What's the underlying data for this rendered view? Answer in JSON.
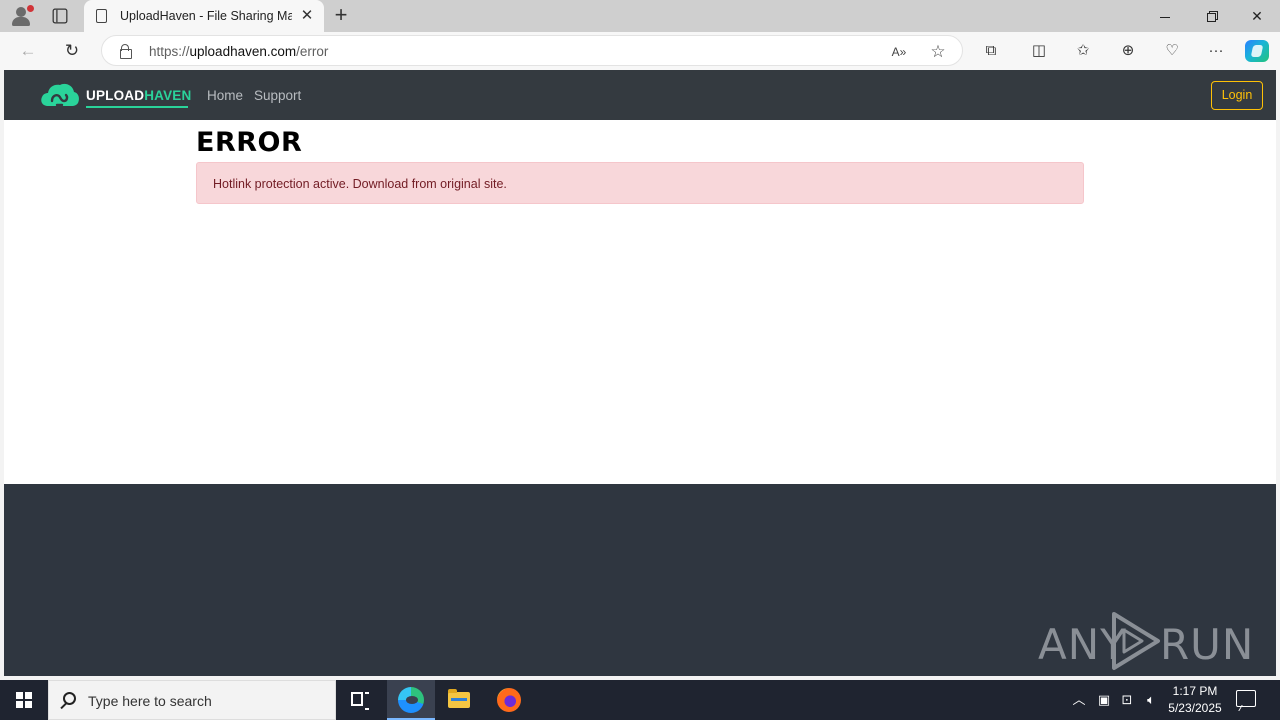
{
  "browser": {
    "tab_title": "UploadHaven - File Sharing Made Easy",
    "url_domain": "uploadhaven.com",
    "url_prefix": "https://",
    "url_path": "/error",
    "icons": [
      "profile-icon",
      "tab-actions-icon",
      "page-icon",
      "close-icon",
      "new-tab-icon",
      "back-icon",
      "reload-icon",
      "lock-icon",
      "read-aloud-icon",
      "favorite-star-icon",
      "extensions-icon",
      "split-screen-icon",
      "favorites-icon",
      "collections-icon",
      "browser-essentials-icon",
      "more-icon",
      "copilot-icon"
    ]
  },
  "site": {
    "logo_main": "UPLOAD",
    "logo_accent": "HAVEN",
    "nav": [
      "Home",
      "Support"
    ],
    "login_label": "Login",
    "error_heading": "ERROR",
    "error_message": "Hotlink protection active. Download from original site.",
    "colors": {
      "navbar": "#343a40",
      "accent": "#2ad39a",
      "login_border": "#ffc107",
      "alert_bg": "#f8d7da",
      "alert_text": "#721c24",
      "footer": "#2f3640"
    }
  },
  "watermark": {
    "left": "ANY",
    "right": "RUN"
  },
  "taskbar": {
    "search_placeholder": "Type here to search",
    "time": "1:17 PM",
    "date": "5/23/2025",
    "pinned": [
      "task-view-icon",
      "edge-icon",
      "file-explorer-icon",
      "firefox-icon"
    ]
  }
}
